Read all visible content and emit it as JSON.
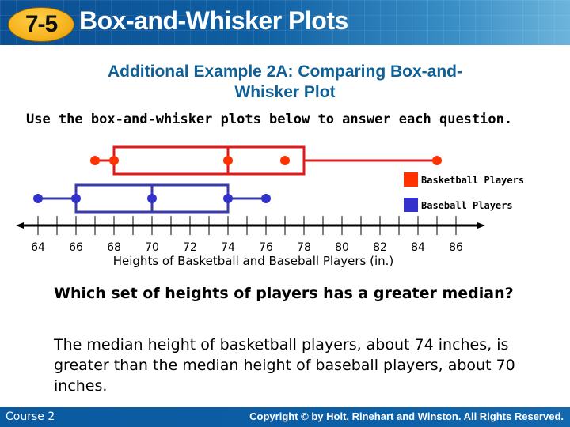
{
  "header": {
    "section_number": "7-5",
    "title": "Box-and-Whisker Plots"
  },
  "example_title": {
    "line1": "Additional Example 2A: Comparing Box-and-",
    "line2": "Whisker Plot"
  },
  "instructions": "Use the box-and-whisker plots below to answer each question.",
  "question": "Which set of heights of players has a greater median?",
  "answer": "The median height of basketball players, about 74 inches, is greater than the median height of baseball players, about 70 inches.",
  "footer": {
    "course": "Course 2",
    "copyright": "Copyright © by Holt, Rinehart and Winston. All Rights Reserved."
  },
  "chart_data": {
    "type": "box",
    "title": "",
    "xlabel": "Heights of Basketball and Baseball Players (in.)",
    "xlim": [
      63,
      87
    ],
    "xticks_major": [
      64,
      66,
      68,
      70,
      72,
      74,
      76,
      78,
      80,
      82,
      84,
      86
    ],
    "xticks_minor": [
      64,
      65,
      66,
      67,
      68,
      69,
      70,
      71,
      72,
      73,
      74,
      75,
      76,
      77,
      78,
      79,
      80,
      81,
      82,
      83,
      84,
      85,
      86
    ],
    "legend_position": "right",
    "series": [
      {
        "name": "Basketball Players",
        "color": "#ff3300",
        "box_color": "#e01b1b",
        "min": 67,
        "q1": 68,
        "median": 74,
        "q3": 78,
        "max": 85,
        "points": [
          67,
          68,
          74,
          77,
          85
        ]
      },
      {
        "name": "Baseball Players",
        "color": "#3333cc",
        "box_color": "#3a3aaa",
        "min": 64,
        "q1": 66,
        "median": 70,
        "q3": 74,
        "max": 76,
        "points": [
          64,
          66,
          70,
          74,
          76
        ]
      }
    ]
  }
}
